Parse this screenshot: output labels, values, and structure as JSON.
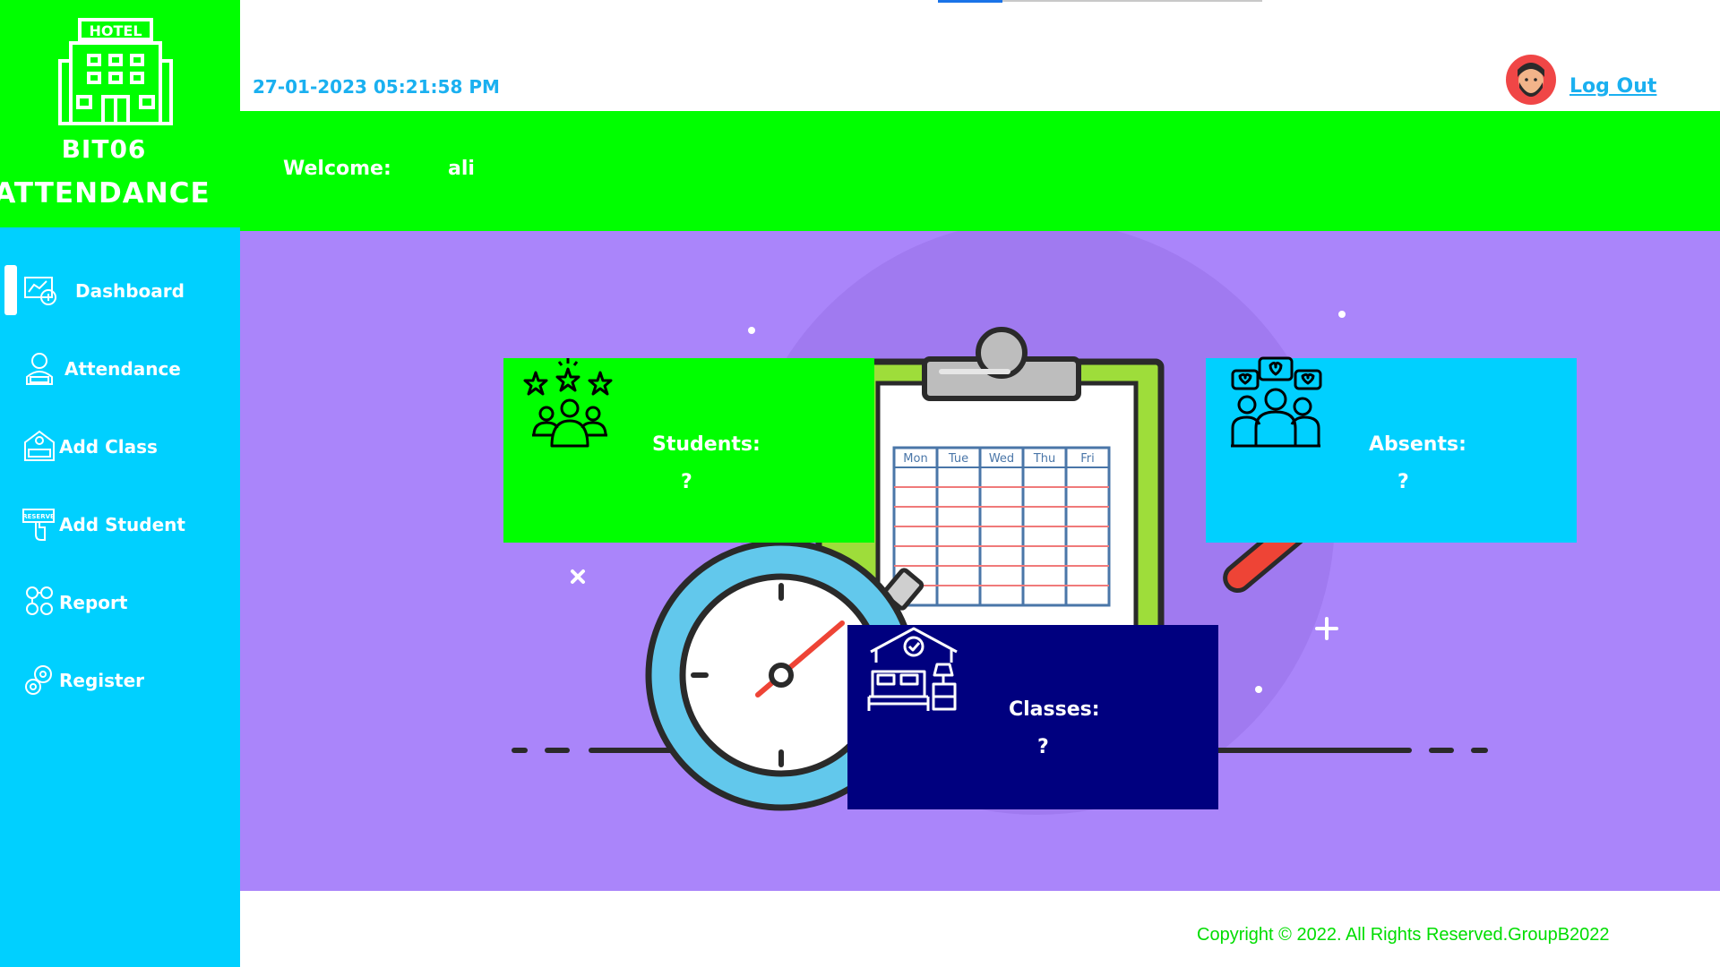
{
  "brand": {
    "line1": "BIT06",
    "line2": "ATTENDANCE",
    "logo_icon": "hotel-building-icon"
  },
  "sidebar": {
    "items": [
      {
        "label": "Dashboard",
        "icon": "dashboard-icon",
        "active": true
      },
      {
        "label": "Attendance",
        "icon": "client-icon",
        "active": false
      },
      {
        "label": "Add Class",
        "icon": "add-class-icon",
        "active": false
      },
      {
        "label": "Add Student",
        "icon": "reserve-icon",
        "active": false
      },
      {
        "label": "Report",
        "icon": "report-icon",
        "active": false
      },
      {
        "label": "Register",
        "icon": "settings-icon",
        "active": false
      }
    ]
  },
  "header": {
    "datetime": "27-01-2023 05:21:58 PM",
    "logout_label": " Log Out",
    "welcome_label": "Welcome:",
    "welcome_user": "ali"
  },
  "cards": {
    "students": {
      "title": "Students:",
      "value": "?",
      "icon": "students-rating-icon"
    },
    "absents": {
      "title": "Absents:",
      "value": "?",
      "icon": "family-hearts-icon"
    },
    "classes": {
      "title": "Classes:",
      "value": "?",
      "icon": "bedroom-icon"
    }
  },
  "footer": {
    "copyright": "Copyright © 2022. All Rights Reserved.GroupB2022"
  },
  "illustration": {
    "calendar_days": [
      "Mon",
      "Tue",
      "Wed",
      "Thu",
      "Fri"
    ]
  },
  "colors": {
    "green": "#00ff00",
    "cyan": "#00d0ff",
    "navy": "#00007f",
    "purple": "#aa85fa",
    "link": "#1ab0f0"
  }
}
